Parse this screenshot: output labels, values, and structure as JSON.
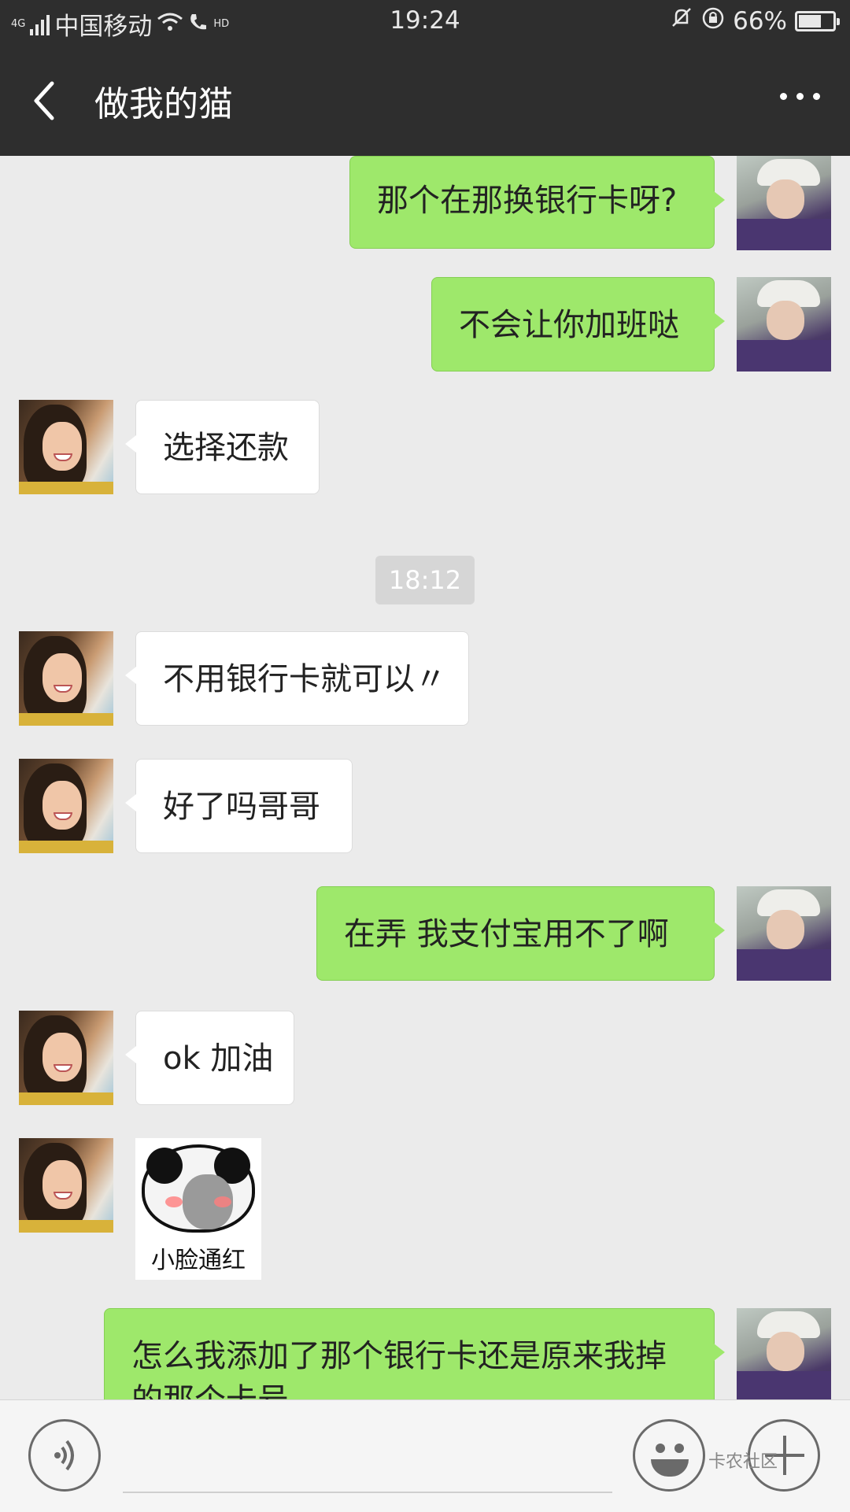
{
  "status_bar": {
    "network_type": "4G",
    "carrier": "中国移动",
    "hd_label": "HD",
    "time": "19:24",
    "battery_percent": "66%",
    "battery_level": 0.66
  },
  "header": {
    "title": "做我的猫"
  },
  "messages": [
    {
      "side": "out",
      "text": "那个在那换银行卡呀?"
    },
    {
      "side": "out",
      "text": "不会让你加班哒"
    },
    {
      "side": "in",
      "text": "选择还款"
    },
    {
      "type": "time",
      "text": "18:12"
    },
    {
      "side": "in",
      "text": "不用银行卡就可以〃"
    },
    {
      "side": "in",
      "text": "好了吗哥哥"
    },
    {
      "side": "out",
      "text": "在弄  我支付宝用不了啊"
    },
    {
      "side": "in",
      "text": "ok 加油"
    },
    {
      "side": "in",
      "type": "sticker",
      "caption": "小脸通红"
    },
    {
      "side": "out",
      "text": "怎么我添加了那个银行卡还是原来我掉的那个卡号"
    }
  ],
  "watermark": "卡农社区",
  "icons": [
    "back-arrow-icon",
    "more-icon",
    "voice-icon",
    "emoji-icon",
    "plus-icon"
  ],
  "colors": {
    "outgoing_bubble": "#9ee86b",
    "incoming_bubble": "#ffffff",
    "header": "#2e2e2e"
  }
}
